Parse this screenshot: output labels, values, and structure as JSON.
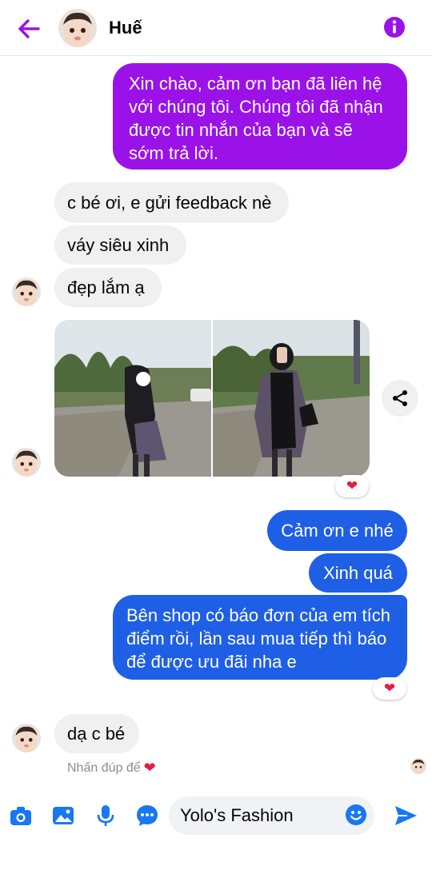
{
  "header": {
    "contact_name": "Huế"
  },
  "messages": {
    "m1": "Xin chào, cảm ơn bạn đã liên hệ với chúng tôi. Chúng tôi đã nhận được tin nhắn của bạn và sẽ sớm trả lời.",
    "m2": "c bé ơi, e gửi feedback nè",
    "m3": "váy siêu xinh",
    "m4": "đẹp lắm ạ",
    "m5": "Cảm ơn e nhé",
    "m6": "Xinh quá",
    "m7": "Bên shop có báo đơn của em tích điểm rồi, lần sau mua tiếp thì báo để được ưu đãi nha e",
    "m8": "dạ c bé"
  },
  "reactions": {
    "photo": "❤",
    "long_message": "❤"
  },
  "hint": {
    "text": "Nhấn đúp để",
    "heart": "❤"
  },
  "composer": {
    "input_value": "Yolo's Fashion"
  },
  "colors": {
    "accent": "#9b12e9",
    "outgoing_blue": "#1f5fe6",
    "incoming": "#f0f0f0",
    "icon_blue": "#1877f2"
  },
  "icons": [
    "back-arrow-icon",
    "info-icon",
    "share-icon",
    "camera-icon",
    "gallery-icon",
    "microphone-icon",
    "chat-more-icon",
    "emoji-icon",
    "send-icon"
  ]
}
